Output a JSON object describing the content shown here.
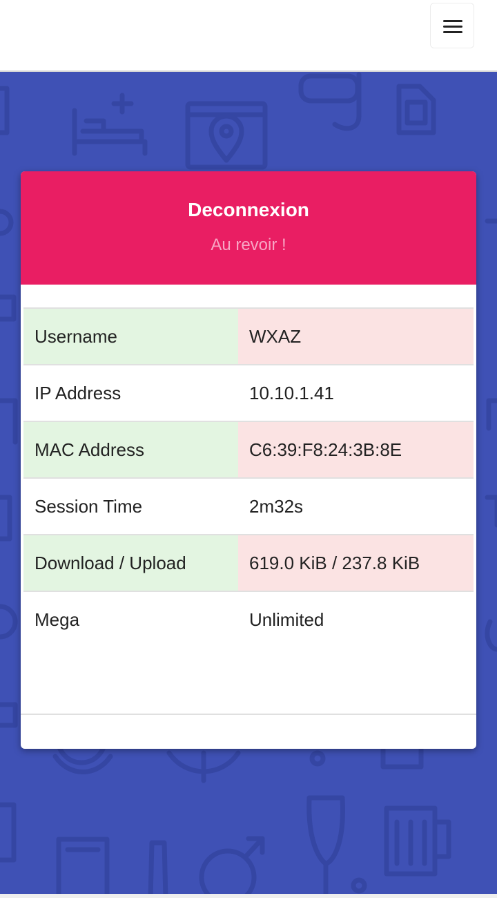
{
  "header": {
    "menu_icon": "hamburger-icon"
  },
  "card": {
    "title": "Deconnexion",
    "subtitle": "Au revoir !",
    "header_color": "#e91e63"
  },
  "session_info": {
    "rows": [
      {
        "label": "Username",
        "value": "WXAZ"
      },
      {
        "label": "IP Address",
        "value": "10.10.1.41"
      },
      {
        "label": "MAC Address",
        "value": "C6:39:F8:24:3B:8E"
      },
      {
        "label": "Session Time",
        "value": "2m32s"
      },
      {
        "label": "Download / Upload",
        "value": "619.0 KiB / 237.8 KiB"
      },
      {
        "label": "Mega",
        "value": "Unlimited"
      }
    ]
  },
  "colors": {
    "background": "#3f51b5",
    "accent": "#e91e63",
    "label_shade": "#e3f5e1",
    "value_shade": "#fbe3e3"
  }
}
